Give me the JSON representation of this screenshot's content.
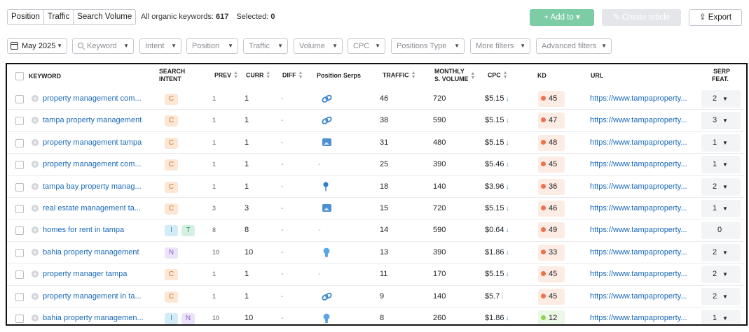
{
  "toolbar": {
    "tabs": [
      "Position",
      "Traffic",
      "Search Volume"
    ],
    "organic_label": "All organic keywords:",
    "organic_count": "617",
    "selected_label": "Selected:",
    "selected_count": "0",
    "add_to_label": "+ Add to ▾",
    "create_article_label": "✎ Create article",
    "export_label": "⇪ Export"
  },
  "filters": {
    "date": "May 2025",
    "keyword_placeholder": "Keyword",
    "items": [
      "Intent",
      "Position",
      "Traffic",
      "Volume",
      "CPC",
      "Positions Type",
      "More filters",
      "Advanced filters"
    ]
  },
  "table": {
    "headers": {
      "keyword": "KEYWORD",
      "intent_line1": "SEARCH",
      "intent_line2": "INTENT",
      "prev": "PREV",
      "curr": "CURR",
      "diff": "DIFF",
      "position_serps": "Position Serps",
      "traffic": "TRAFFIC",
      "volume_line1": "MONTHLY",
      "volume_line2": "S. VOLUME",
      "cpc": "CPC",
      "kd": "KD",
      "url": "URL",
      "serp_line1": "SERP",
      "serp_line2": "FEAT."
    },
    "rows": [
      {
        "keyword": "property management com...",
        "intents": [
          "C"
        ],
        "prev": "1",
        "curr": "1",
        "diff": "-",
        "pos_icon": "link-icon",
        "traffic": "46",
        "volume": "720",
        "cpc": "$5.15",
        "cpc_mark": "arrow",
        "kd": "45",
        "kd_color": "#f0714a",
        "url": "https://www.tampaproperty...",
        "serp": "2",
        "serp_caret": true
      },
      {
        "keyword": "tampa property management",
        "intents": [
          "C"
        ],
        "prev": "1",
        "curr": "1",
        "diff": "-",
        "pos_icon": "link-icon",
        "traffic": "38",
        "volume": "590",
        "cpc": "$5.15",
        "cpc_mark": "arrow",
        "kd": "47",
        "kd_color": "#f0714a",
        "url": "https://www.tampaproperty...",
        "serp": "3",
        "serp_caret": true
      },
      {
        "keyword": "property management tampa",
        "intents": [
          "C"
        ],
        "prev": "1",
        "curr": "1",
        "diff": "-",
        "pos_icon": "image-icon",
        "traffic": "31",
        "volume": "480",
        "cpc": "$5.15",
        "cpc_mark": "arrow",
        "kd": "48",
        "kd_color": "#f0714a",
        "url": "https://www.tampaproperty...",
        "serp": "1",
        "serp_caret": true
      },
      {
        "keyword": "property management com...",
        "intents": [
          "C"
        ],
        "prev": "1",
        "curr": "1",
        "diff": "-",
        "pos_icon": "dash",
        "traffic": "25",
        "volume": "390",
        "cpc": "$5.46",
        "cpc_mark": "arrow",
        "kd": "45",
        "kd_color": "#f0714a",
        "url": "https://www.tampaproperty...",
        "serp": "1",
        "serp_caret": true
      },
      {
        "keyword": "tampa bay property manag...",
        "intents": [
          "C"
        ],
        "prev": "1",
        "curr": "1",
        "diff": "-",
        "pos_icon": "pin-icon",
        "traffic": "18",
        "volume": "140",
        "cpc": "$3.96",
        "cpc_mark": "arrow",
        "kd": "36",
        "kd_color": "#f0714a",
        "url": "https://www.tampaproperty...",
        "serp": "2",
        "serp_caret": true
      },
      {
        "keyword": "real estate management ta...",
        "intents": [
          "C"
        ],
        "prev": "3",
        "curr": "3",
        "diff": "-",
        "pos_icon": "image-icon",
        "traffic": "15",
        "volume": "720",
        "cpc": "$5.15",
        "cpc_mark": "arrow",
        "kd": "46",
        "kd_color": "#f0714a",
        "url": "https://www.tampaproperty...",
        "serp": "1",
        "serp_caret": true
      },
      {
        "keyword": "homes for rent in tampa",
        "intents": [
          "I",
          "T"
        ],
        "prev": "8",
        "curr": "8",
        "diff": "-",
        "pos_icon": "dash",
        "traffic": "14",
        "volume": "590",
        "cpc": "$0.64",
        "cpc_mark": "arrow",
        "kd": "49",
        "kd_color": "#f0714a",
        "url": "https://www.tampaproperty...",
        "serp": "0",
        "serp_caret": false
      },
      {
        "keyword": "bahia property management",
        "intents": [
          "N"
        ],
        "prev": "10",
        "curr": "10",
        "diff": "-",
        "pos_icon": "bulb-icon",
        "traffic": "13",
        "volume": "390",
        "cpc": "$1.86",
        "cpc_mark": "arrow",
        "kd": "33",
        "kd_color": "#f0714a",
        "url": "https://www.tampaproperty...",
        "serp": "2",
        "serp_caret": true
      },
      {
        "keyword": "property manager tampa",
        "intents": [
          "C"
        ],
        "prev": "1",
        "curr": "1",
        "diff": "-",
        "pos_icon": "dash",
        "traffic": "11",
        "volume": "170",
        "cpc": "$5.15",
        "cpc_mark": "arrow",
        "kd": "45",
        "kd_color": "#f0714a",
        "url": "https://www.tampaproperty...",
        "serp": "2",
        "serp_caret": true
      },
      {
        "keyword": "property management in ta...",
        "intents": [
          "C"
        ],
        "prev": "1",
        "curr": "1",
        "diff": "-",
        "pos_icon": "link-icon",
        "traffic": "9",
        "volume": "140",
        "cpc": "$5.7",
        "cpc_mark": "bar",
        "kd": "45",
        "kd_color": "#f0714a",
        "url": "https://www.tampaproperty...",
        "serp": "2",
        "serp_caret": true
      },
      {
        "keyword": "bahia property managemen...",
        "intents": [
          "I",
          "N"
        ],
        "prev": "10",
        "curr": "10",
        "diff": "-",
        "pos_icon": "bulb-icon",
        "traffic": "8",
        "volume": "260",
        "cpc": "$1.86",
        "cpc_mark": "arrow",
        "kd": "12",
        "kd_color": "#8fd14f",
        "url": "https://www.tampaproperty...",
        "serp": "1",
        "serp_caret": true
      }
    ]
  },
  "colors": {
    "link": "#1a6ab9",
    "accent_green": "#7ccca6",
    "kd_high": "#f0714a",
    "kd_low": "#8fd14f"
  }
}
